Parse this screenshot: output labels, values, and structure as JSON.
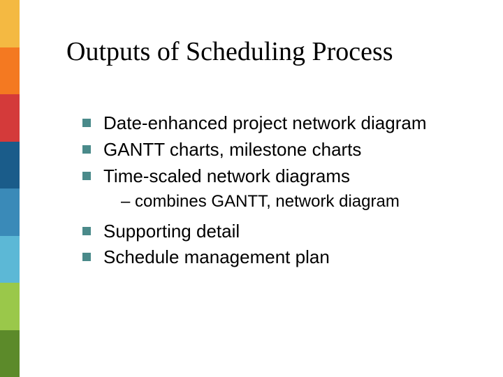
{
  "sidebar_colors": [
    "#f4b942",
    "#f47921",
    "#d43a3a",
    "#1a5c8a",
    "#3a8ab8",
    "#5cb8d6",
    "#9ac84a",
    "#5c8a2a"
  ],
  "title": "Outputs of Scheduling Process",
  "bullets_group1": [
    "Date-enhanced project network diagram",
    "GANTT charts, milestone charts",
    "Time-scaled network diagrams"
  ],
  "sub_bullet": "– combines GANTT, network diagram",
  "bullets_group2": [
    "Supporting detail",
    "Schedule management plan"
  ]
}
